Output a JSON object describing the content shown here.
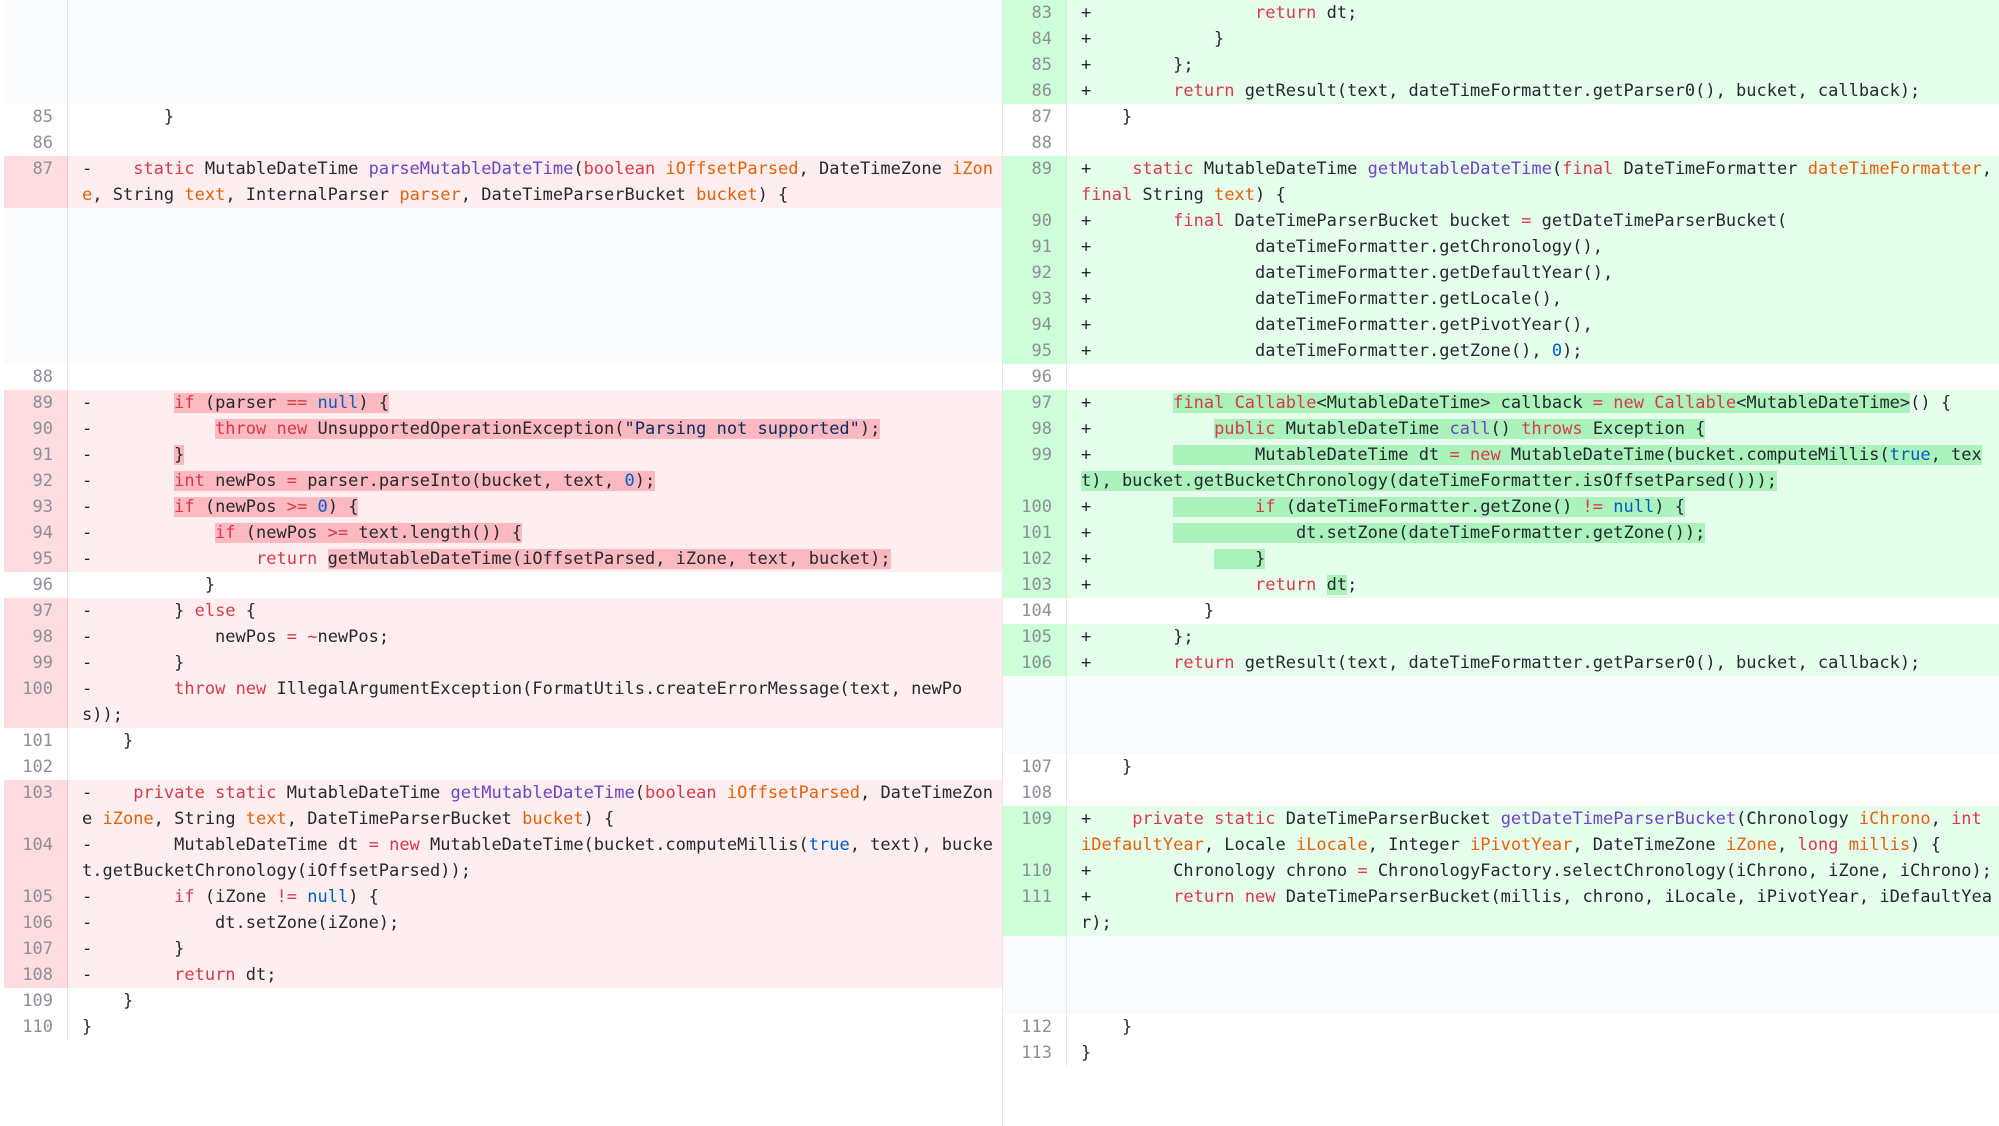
{
  "view": "split-diff",
  "colors": {
    "deleted_bg": "#ffeef0",
    "deleted_gutter": "#ffdce0",
    "added_bg": "#e6ffed",
    "added_gutter": "#cdffd8",
    "keyword": "#d73a49",
    "function": "#6f42c1",
    "variable": "#e36209",
    "number": "#005cc5",
    "string": "#032f62"
  },
  "left_lines": [
    {
      "type": "empty",
      "num": "",
      "code": "",
      "h": 4
    },
    {
      "type": "ctx",
      "num": "85",
      "code": "        }"
    },
    {
      "type": "ctx",
      "num": "86",
      "code": ""
    },
    {
      "type": "del",
      "num": "87",
      "code": "-    [k]static[/k] MutableDateTime [f]parseMutableDateTime[/f]([k]boolean[/k] [v]iOffsetParsed[/v], DateTimeZone [v]iZone[/v], String [v]text[/v], InternalParser [v]parser[/v], DateTimeParserBucket [v]bucket[/v]) {"
    },
    {
      "type": "empty",
      "num": "",
      "code": "",
      "h": 6
    },
    {
      "type": "ctx",
      "num": "88",
      "code": ""
    },
    {
      "type": "del",
      "num": "89",
      "code": "-        [hd][k]if[/k] (parser [k]==[/k] [n]null[/n]) {[/hd]"
    },
    {
      "type": "del",
      "num": "90",
      "code": "-            [hd][k]throw[/k] [k]new[/k] UnsupportedOperationException([s]\"Parsing not supported\"[/s]);[/hd]"
    },
    {
      "type": "del",
      "num": "91",
      "code": "-        [hd]}[/hd]"
    },
    {
      "type": "del",
      "num": "92",
      "code": "-        [hd][k]int[/k] newPos [k]=[/k] parser.parseInto(bucket, text, [n]0[/n]);[/hd]"
    },
    {
      "type": "del",
      "num": "93",
      "code": "-        [hd][k]if[/k] (newPos [k]>=[/k] [n]0[/n]) {[/hd]"
    },
    {
      "type": "del",
      "num": "94",
      "code": "-            [hd][k]if[/k] (newPos [k]>=[/k] text.length()) {[/hd]"
    },
    {
      "type": "del",
      "num": "95",
      "code": "-                [k]return[/k] [hd]getMutableDateTime(iOffsetParsed, iZone, text, bucket);[/hd]"
    },
    {
      "type": "ctx",
      "num": "96",
      "code": "            }"
    },
    {
      "type": "del",
      "num": "97",
      "code": "-        } [k]else[/k] {"
    },
    {
      "type": "del",
      "num": "98",
      "code": "-            newPos [k]=[/k] [k]~[/k]newPos;"
    },
    {
      "type": "del",
      "num": "99",
      "code": "-        }"
    },
    {
      "type": "del",
      "num": "100",
      "code": "-        [k]throw[/k] [k]new[/k] IllegalArgumentException(FormatUtils.createErrorMessage(text, newPos));"
    },
    {
      "type": "ctx",
      "num": "101",
      "code": "    }"
    },
    {
      "type": "ctx",
      "num": "102",
      "code": ""
    },
    {
      "type": "del",
      "num": "103",
      "code": "-    [k]private[/k] [k]static[/k] MutableDateTime [f]getMutableDateTime[/f]([k]boolean[/k] [v]iOffsetParsed[/v], DateTimeZone [v]iZone[/v], String [v]text[/v], DateTimeParserBucket [v]bucket[/v]) {"
    },
    {
      "type": "del",
      "num": "104",
      "code": "-        MutableDateTime dt [k]=[/k] [k]new[/k] MutableDateTime(bucket.computeMillis([n]true[/n], text), bucket.getBucketChronology(iOffsetParsed));"
    },
    {
      "type": "del",
      "num": "105",
      "code": "-        [k]if[/k] (iZone [k]!=[/k] [n]null[/n]) {"
    },
    {
      "type": "del",
      "num": "106",
      "code": "-            dt.setZone(iZone);"
    },
    {
      "type": "del",
      "num": "107",
      "code": "-        }"
    },
    {
      "type": "del",
      "num": "108",
      "code": "-        [k]return[/k] dt;"
    },
    {
      "type": "ctx",
      "num": "109",
      "code": "    }"
    },
    {
      "type": "ctx",
      "num": "110",
      "code": "}"
    }
  ],
  "right_lines": [
    {
      "type": "add",
      "num": "83",
      "code": "+                [k]return[/k] dt;"
    },
    {
      "type": "add",
      "num": "84",
      "code": "+            }"
    },
    {
      "type": "add",
      "num": "85",
      "code": "+        };"
    },
    {
      "type": "add",
      "num": "86",
      "code": "+        [k]return[/k] getResult(text, dateTimeFormatter.getParser0(), bucket, callback);"
    },
    {
      "type": "ctx",
      "num": "87",
      "code": "    }"
    },
    {
      "type": "ctx",
      "num": "88",
      "code": ""
    },
    {
      "type": "add",
      "num": "89",
      "code": "+    [k]static[/k] MutableDateTime [f]getMutableDateTime[/f]([k]final[/k] DateTimeFormatter [v]dateTimeFormatter[/v], [k]final[/k] String [v]text[/v]) {"
    },
    {
      "type": "add",
      "num": "90",
      "code": "+        [k]final[/k] DateTimeParserBucket bucket [k]=[/k] getDateTimeParserBucket("
    },
    {
      "type": "add",
      "num": "91",
      "code": "+                dateTimeFormatter.getChronology(),"
    },
    {
      "type": "add",
      "num": "92",
      "code": "+                dateTimeFormatter.getDefaultYear(),"
    },
    {
      "type": "add",
      "num": "93",
      "code": "+                dateTimeFormatter.getLocale(),"
    },
    {
      "type": "add",
      "num": "94",
      "code": "+                dateTimeFormatter.getPivotYear(),"
    },
    {
      "type": "add",
      "num": "95",
      "code": "+                dateTimeFormatter.getZone(), [n]0[/n]);"
    },
    {
      "type": "ctx",
      "num": "96",
      "code": ""
    },
    {
      "type": "add",
      "num": "97",
      "code": "+        [ha][k]final[/k] [k]Callable[/k]<MutableDateTime> callback [k]=[/k] [k]new[/k] [k]Callable[/k]<MutableDateTime>[/ha]() {"
    },
    {
      "type": "add",
      "num": "98",
      "code": "+            [ha][k]public[/k] MutableDateTime [f]call[/f]() [k]throws[/k] Exception {[/ha]"
    },
    {
      "type": "add",
      "num": "99",
      "code": "+        [ha]        MutableDateTime dt [k]=[/k] [k]new[/k] MutableDateTime(bucket.computeMillis([n]true[/n], text), bucket.getBucketChronology(dateTimeFormatter.isOffsetParsed()));[/ha]"
    },
    {
      "type": "add",
      "num": "100",
      "code": "+        [ha]        [k]if[/k] (dateTimeFormatter.getZone() [k]!=[/k] [n]null[/n]) {[/ha]"
    },
    {
      "type": "add",
      "num": "101",
      "code": "+        [ha]            dt.setZone(dateTimeFormatter.getZone());[/ha]"
    },
    {
      "type": "add",
      "num": "102",
      "code": "+            [ha]    }[/ha]"
    },
    {
      "type": "add",
      "num": "103",
      "code": "+                [k]return[/k] [ha]dt[/ha];"
    },
    {
      "type": "ctx",
      "num": "104",
      "code": "            }"
    },
    {
      "type": "add",
      "num": "105",
      "code": "+        };"
    },
    {
      "type": "add",
      "num": "106",
      "code": "+        [k]return[/k] getResult(text, dateTimeFormatter.getParser0(), bucket, callback);"
    },
    {
      "type": "empty",
      "num": "",
      "code": "",
      "h": 3
    },
    {
      "type": "ctx",
      "num": "107",
      "code": "    }"
    },
    {
      "type": "ctx",
      "num": "108",
      "code": ""
    },
    {
      "type": "add",
      "num": "109",
      "code": "+    [k]private[/k] [k]static[/k] DateTimeParserBucket [f]getDateTimeParserBucket[/f](Chronology [v]iChrono[/v], [k]int[/k] [v]iDefaultYear[/v], Locale [v]iLocale[/v], Integer [v]iPivotYear[/v], DateTimeZone [v]iZone[/v], [k]long[/k] [v]millis[/v]) {"
    },
    {
      "type": "add",
      "num": "110",
      "code": "+        Chronology chrono [k]=[/k] ChronologyFactory.selectChronology(iChrono, iZone, iChrono);"
    },
    {
      "type": "add",
      "num": "111",
      "code": "+        [k]return[/k] [k]new[/k] DateTimeParserBucket(millis, chrono, iLocale, iPivotYear, iDefaultYear);"
    },
    {
      "type": "empty",
      "num": "",
      "code": "",
      "h": 3
    },
    {
      "type": "ctx",
      "num": "112",
      "code": "    }"
    },
    {
      "type": "ctx",
      "num": "113",
      "code": "}"
    }
  ]
}
